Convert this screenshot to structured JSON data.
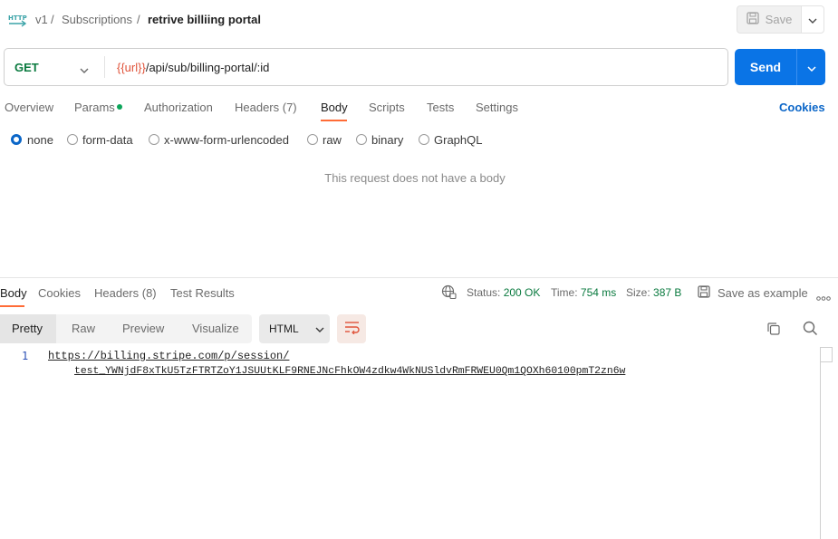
{
  "header": {
    "breadcrumb": [
      "v1",
      "Subscriptions"
    ],
    "current": "retrive billiing portal",
    "save_label": "Save"
  },
  "request": {
    "method": "GET",
    "url_variable": "{{url}}",
    "url_path": "/api/sub/billing-portal/:id",
    "send_label": "Send"
  },
  "request_tabs": {
    "overview": "Overview",
    "params": "Params",
    "authorization": "Authorization",
    "headers": "Headers (7)",
    "body": "Body",
    "scripts": "Scripts",
    "tests": "Tests",
    "settings": "Settings",
    "cookies": "Cookies"
  },
  "body_types": [
    "none",
    "form-data",
    "x-www-form-urlencoded",
    "raw",
    "binary",
    "GraphQL"
  ],
  "no_body_message": "This request does not have a body",
  "response_tabs": {
    "body": "Body",
    "cookies": "Cookies",
    "headers": "Headers (8)",
    "test_results": "Test Results"
  },
  "response_meta": {
    "status_label": "Status:",
    "status_value": "200 OK",
    "time_label": "Time:",
    "time_value": "754 ms",
    "size_label": "Size:",
    "size_value": "387 B",
    "save_example": "Save as example",
    "more": "ooo"
  },
  "view_modes": [
    "Pretty",
    "Raw",
    "Preview",
    "Visualize"
  ],
  "format": "HTML",
  "response_body": {
    "line_number": "1",
    "line1": "https://billing.stripe.com/p/session/",
    "line2": "test_YWNjdF8xTkU5TzFTRTZoY1JSUUtKLF9RNEJNcFhkOW4zdkw4WkNUSldvRmFRWEU0Qm1QOXh60100pmT2zn6w"
  },
  "colors": {
    "accent_orange": "#ff6c37",
    "send_blue": "#0a74e6",
    "status_green": "#0a7a3f",
    "variable_red": "#e0533a"
  }
}
